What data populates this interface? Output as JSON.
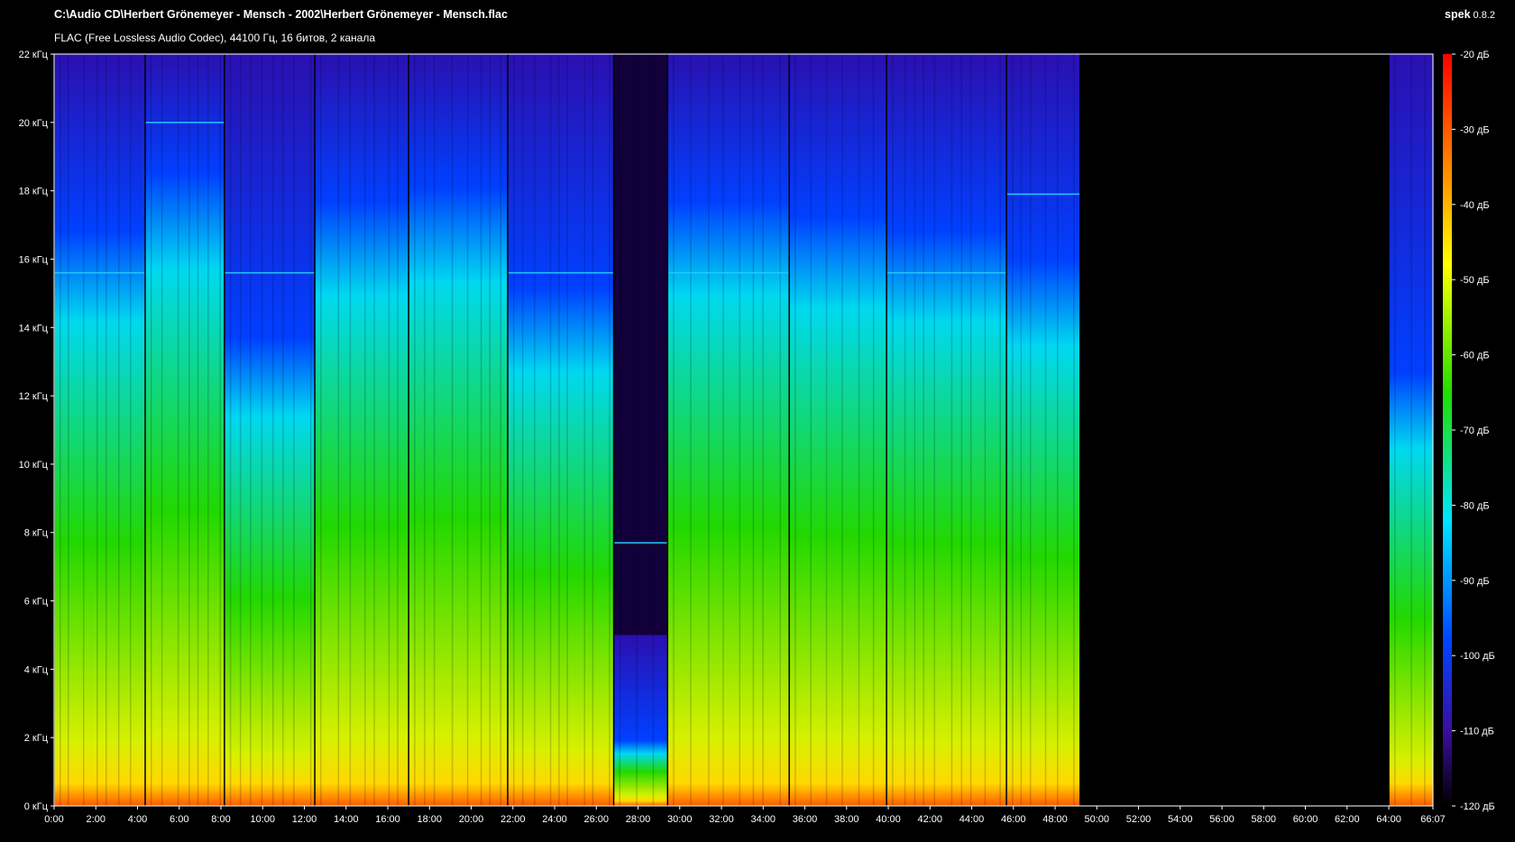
{
  "header": {
    "file_path": "C:\\Audio CD\\Herbert Grönemeyer - Mensch - 2002\\Herbert Grönemeyer - Mensch.flac",
    "file_info": "FLAC (Free Lossless Audio Codec), 44100 Гц, 16 битов, 2 канала"
  },
  "app": {
    "name": "spek",
    "version": "0.8.2"
  },
  "colors": {
    "background": "#000000",
    "axis": "#ffffff",
    "text": "#ffffff"
  },
  "chart_data": {
    "type": "heatmap",
    "x_ticks": [
      "0:00",
      "2:00",
      "4:00",
      "6:00",
      "8:00",
      "10:00",
      "12:00",
      "14:00",
      "16:00",
      "18:00",
      "20:00",
      "22:00",
      "24:00",
      "26:00",
      "28:00",
      "30:00",
      "32:00",
      "34:00",
      "36:00",
      "38:00",
      "40:00",
      "42:00",
      "44:00",
      "46:00",
      "48:00",
      "50:00",
      "52:00",
      "54:00",
      "56:00",
      "58:00",
      "60:00",
      "62:00",
      "64:00",
      "66:07"
    ],
    "x_tick_values_sec": [
      0,
      120,
      240,
      360,
      480,
      600,
      720,
      840,
      960,
      1080,
      1200,
      1320,
      1440,
      1560,
      1680,
      1800,
      1920,
      2040,
      2160,
      2280,
      2400,
      2520,
      2640,
      2760,
      2880,
      3000,
      3120,
      3240,
      3360,
      3480,
      3600,
      3720,
      3840,
      3967
    ],
    "x_range_sec": [
      0,
      3967
    ],
    "y_ticks": [
      "0 кГц",
      "2 кГц",
      "4 кГц",
      "6 кГц",
      "8 кГц",
      "10 кГц",
      "12 кГц",
      "14 кГц",
      "16 кГц",
      "18 кГц",
      "20 кГц",
      "22 кГц"
    ],
    "y_tick_values_khz": [
      0,
      2,
      4,
      6,
      8,
      10,
      12,
      14,
      16,
      18,
      20,
      22
    ],
    "y_range_khz": [
      0,
      22
    ],
    "colorbar_ticks": [
      "-20 дБ",
      "-30 дБ",
      "-40 дБ",
      "-50 дБ",
      "-60 дБ",
      "-70 дБ",
      "-80 дБ",
      "-90 дБ",
      "-100 дБ",
      "-110 дБ",
      "-120 дБ"
    ],
    "colorbar_tick_values_db": [
      -20,
      -30,
      -40,
      -50,
      -60,
      -70,
      -80,
      -90,
      -100,
      -110,
      -120
    ],
    "colorbar_range_db": [
      -120,
      -20
    ],
    "tracks": [
      {
        "start_sec": 0,
        "end_sec": 262,
        "level": 0.7,
        "cutoff_khz": 22.0,
        "hf_line_khz": 15.6
      },
      {
        "start_sec": 262,
        "end_sec": 490,
        "level": 0.78,
        "cutoff_khz": 22.0,
        "hf_line_khz": 20.0
      },
      {
        "start_sec": 490,
        "end_sec": 750,
        "level": 0.55,
        "cutoff_khz": 22.0,
        "hf_line_khz": 15.6
      },
      {
        "start_sec": 750,
        "end_sec": 1020,
        "level": 0.74,
        "cutoff_khz": 22.0,
        "hf_line_khz": null
      },
      {
        "start_sec": 1020,
        "end_sec": 1305,
        "level": 0.76,
        "cutoff_khz": 22.0,
        "hf_line_khz": null
      },
      {
        "start_sec": 1305,
        "end_sec": 1610,
        "level": 0.62,
        "cutoff_khz": 22.0,
        "hf_line_khz": 15.6
      },
      {
        "start_sec": 1610,
        "end_sec": 1765,
        "level": 0.3,
        "cutoff_khz": 5.0,
        "hf_line_khz": 7.7
      },
      {
        "start_sec": 1765,
        "end_sec": 2115,
        "level": 0.74,
        "cutoff_khz": 22.0,
        "hf_line_khz": 15.6
      },
      {
        "start_sec": 2115,
        "end_sec": 2395,
        "level": 0.72,
        "cutoff_khz": 22.0,
        "hf_line_khz": null
      },
      {
        "start_sec": 2395,
        "end_sec": 2740,
        "level": 0.7,
        "cutoff_khz": 22.0,
        "hf_line_khz": 15.6
      },
      {
        "start_sec": 2740,
        "end_sec": 2950,
        "level": 0.66,
        "cutoff_khz": 22.0,
        "hf_line_khz": 17.9
      },
      {
        "start_sec": 2950,
        "end_sec": 3840,
        "level": 0.0,
        "cutoff_khz": 0.0,
        "hf_line_khz": null
      },
      {
        "start_sec": 3840,
        "end_sec": 3967,
        "level": 0.5,
        "cutoff_khz": 22.0,
        "hf_line_khz": null
      }
    ]
  }
}
